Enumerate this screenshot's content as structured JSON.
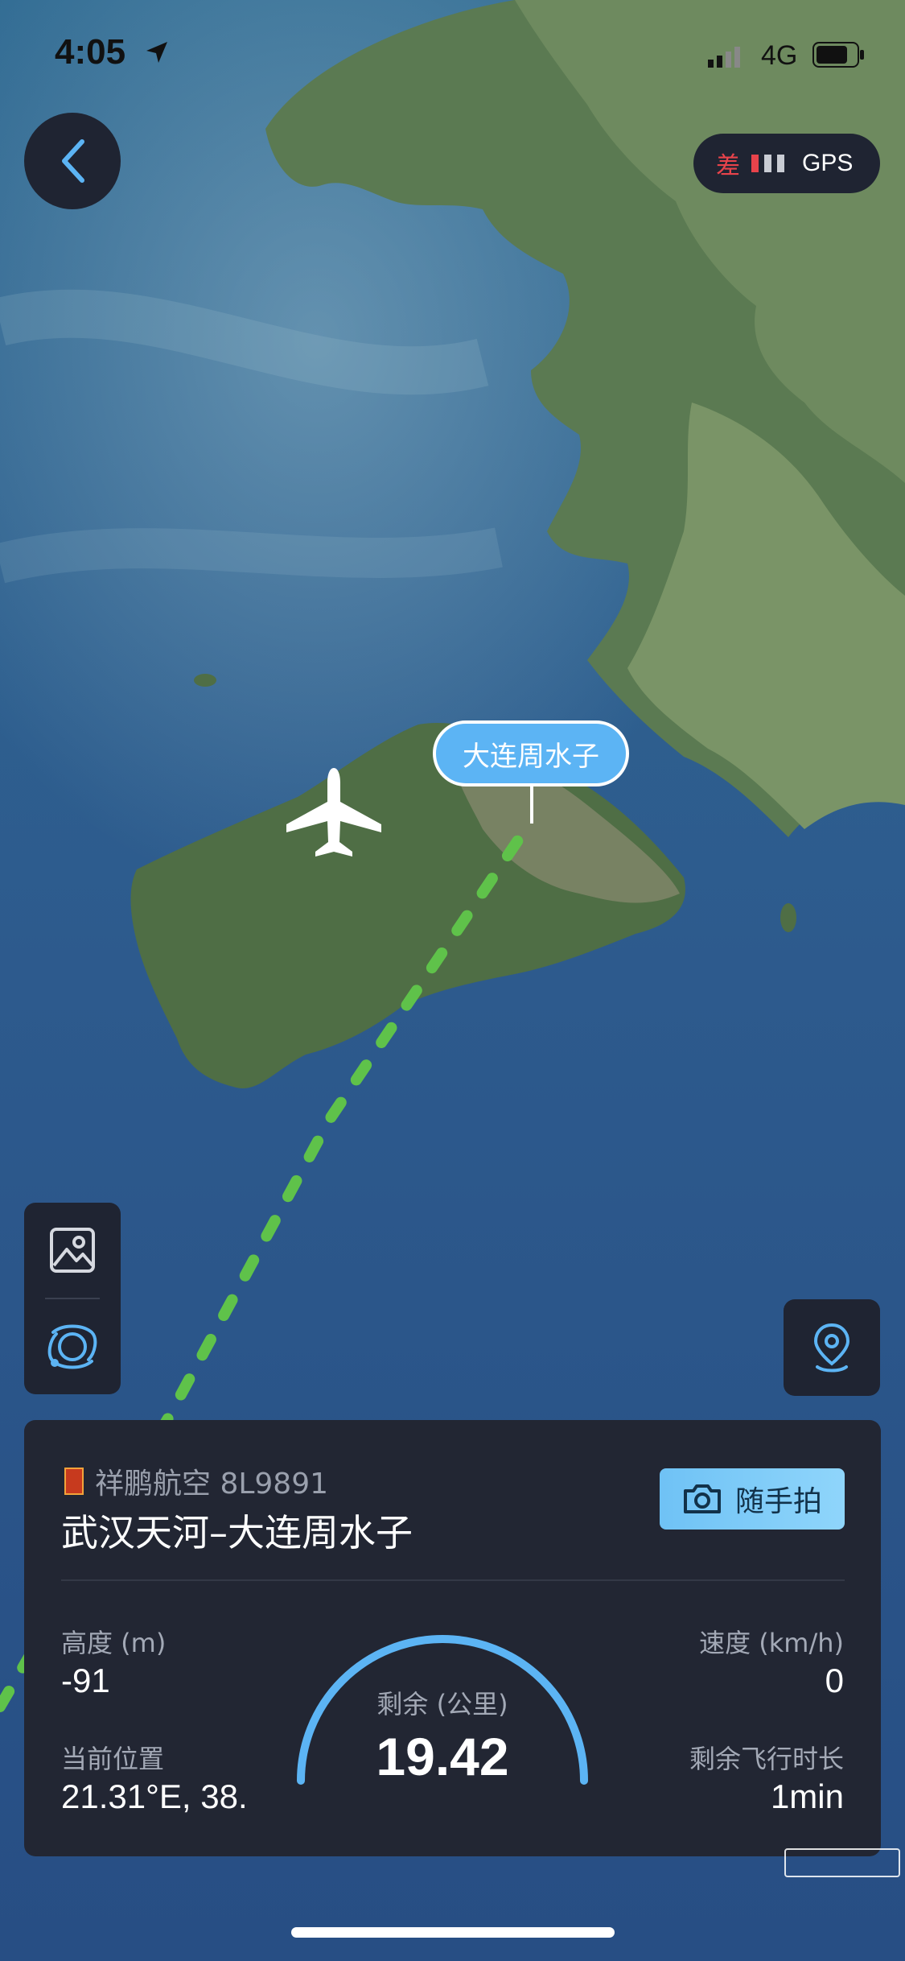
{
  "status_bar": {
    "time": "4:05",
    "network": "4G"
  },
  "gps": {
    "quality": "差",
    "label": "GPS",
    "signal_bars_active": 1,
    "signal_bars_total": 3
  },
  "map": {
    "destination_label": "大连周水子"
  },
  "flight": {
    "airline": "祥鹏航空 8L9891",
    "route": "武汉天河–大连周水子",
    "snap_button": "随手拍"
  },
  "stats": {
    "altitude_label": "高度 (m)",
    "altitude_value": "-91",
    "position_label": "当前位置",
    "position_value": "21.31°E, 38.",
    "speed_label": "速度 (km/h)",
    "speed_value": "0",
    "time_left_label": "剩余飞行时长",
    "time_left_value": "1min",
    "remaining_label": "剩余 (公里)",
    "remaining_value": "19.42"
  },
  "colors": {
    "panel_bg": "#222633",
    "accent_blue": "#5cb4f4",
    "route_green": "#5fc24a",
    "gps_bad_red": "#e8434b"
  }
}
